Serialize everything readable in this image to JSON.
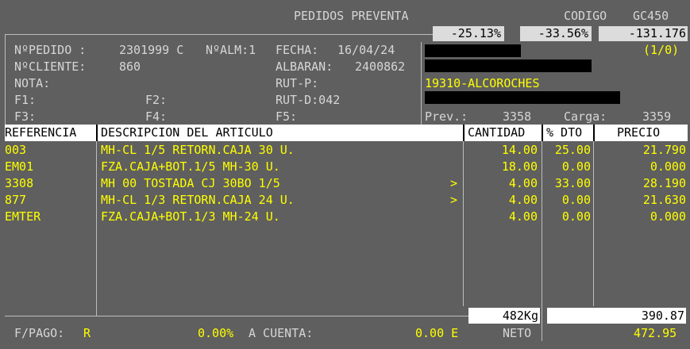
{
  "header": {
    "title": "PEDIDOS PREVENTA",
    "codigo_label": "CODIGO",
    "codigo_value": "GC450",
    "pct1": "-25.13%",
    "pct2": "-33.56%",
    "pct3": "-131.176"
  },
  "order": {
    "npedido_label": "NºPEDIDO :",
    "npedido_value": "2301999 C",
    "nalm_label": "NºALM:1",
    "fecha_label": "FECHA:",
    "fecha_value": "16/04/24",
    "ncliente_label": "NºCLIENTE:",
    "ncliente_value": "860",
    "albaran_label": "ALBARAN:",
    "albaran_value": "2400862",
    "nota_label": "NOTA:",
    "rutp_label": "RUT-P:",
    "f1_label": "F1:",
    "f2_label": "F2:",
    "rutd_label": "RUT-D:042",
    "f3_label": "F3:",
    "f4_label": "F4:",
    "f5_label": "F5:",
    "page_indicator": "(1/0)",
    "route_name": "19310-ALCOROCHES",
    "prev_label": "Prev.:",
    "prev_value": "3358",
    "carga_label": "Carga:",
    "carga_value": "3359"
  },
  "table": {
    "headers": {
      "referencia": "REFERENCIA",
      "descripcion": "DESCRIPCION DEL ARTICULO",
      "cantidad": "CANTIDAD",
      "dto": "% DTO",
      "precio": "PRECIO"
    },
    "rows": [
      {
        "ref": "003",
        "desc": "MH-CL 1/5 RETORN.CAJA 30 U.",
        "arrow": "",
        "cantidad": "14.00",
        "dto": "25.00",
        "precio": "21.790"
      },
      {
        "ref": "EM01",
        "desc": "FZA.CAJA+BOT.1/5 MH-30 U.",
        "arrow": "",
        "cantidad": "18.00",
        "dto": "0.00",
        "precio": "0.000"
      },
      {
        "ref": "3308",
        "desc": "MH 00 TOSTADA CJ 30BO 1/5",
        "arrow": ">",
        "cantidad": "4.00",
        "dto": "33.00",
        "precio": "28.190"
      },
      {
        "ref": "877",
        "desc": "MH-CL 1/3 RETORN.CAJA 24 U.",
        "arrow": ">",
        "cantidad": "4.00",
        "dto": "0.00",
        "precio": "21.630"
      },
      {
        "ref": "EMTER",
        "desc": "FZA.CAJA+BOT.1/3 MH-24 U.",
        "arrow": "",
        "cantidad": "4.00",
        "dto": "0.00",
        "precio": "0.000"
      }
    ]
  },
  "totals": {
    "weight": "482Kg",
    "subtotal": "390.87",
    "fpago_label": "F/PAGO:",
    "fpago_value": "R",
    "pct_value": "0.00%",
    "acuenta_label": "A CUENTA:",
    "acuenta_value": "0.00 E",
    "neto_label": "NETO",
    "neto_value": "472.95"
  },
  "colors": {
    "background": "#5f5f5f",
    "text": "#d6d6d6",
    "highlight": "#ffff00",
    "header_bg": "#ffffff"
  }
}
